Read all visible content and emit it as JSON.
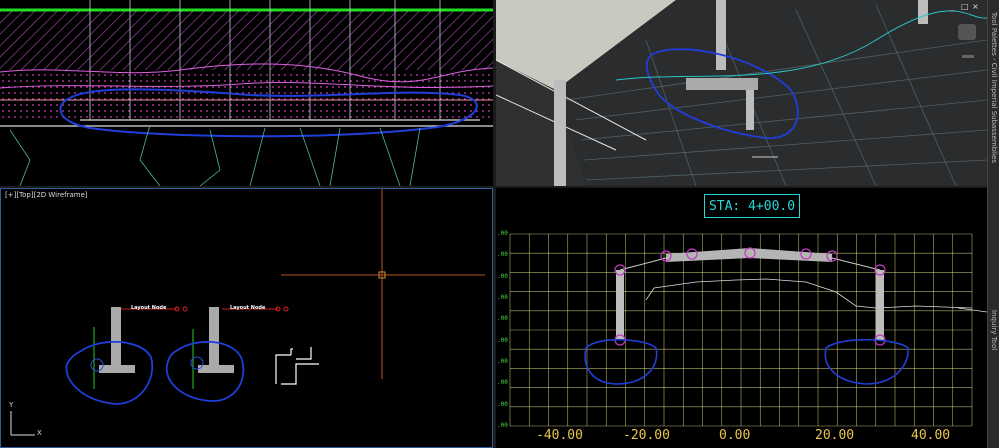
{
  "viewport_bottom_left": {
    "label": "[+][Top][2D Wireframe]",
    "layout_nodes": [
      "Layout Node",
      "Layout Node"
    ],
    "ucs": {
      "y": "Y",
      "x": "X"
    }
  },
  "viewport_top_right": {
    "controls": {
      "minimize": "_",
      "restore": "□",
      "close": "×"
    }
  },
  "viewport_bottom_right": {
    "station_label": "STA: 4+00.0"
  },
  "palettes": {
    "tool_palettes_label": "Tool Palettes - Civil Imperial Subassemblies",
    "inquiry_tool_label": "Inquiry Tool"
  },
  "colors": {
    "background": "#000000",
    "grid": "#d8e08a",
    "axis_labels": "#e8c84a",
    "station": "#29d6d6",
    "blue_outline": "#1f3fd8",
    "crosshair": "#b5561f"
  },
  "chart_data": {
    "type": "line",
    "title": "STA: 4+00.0",
    "x_tick_labels": [
      "-40.00",
      "-20.00",
      "0.00",
      "20.00",
      "40.00"
    ],
    "y_tick_labels": [
      ".00",
      ".00",
      ".00",
      ".00",
      ".00",
      ".00",
      ".00",
      ".00",
      ".00",
      ".00"
    ],
    "xlim": [
      -50,
      50
    ],
    "grid": true
  }
}
